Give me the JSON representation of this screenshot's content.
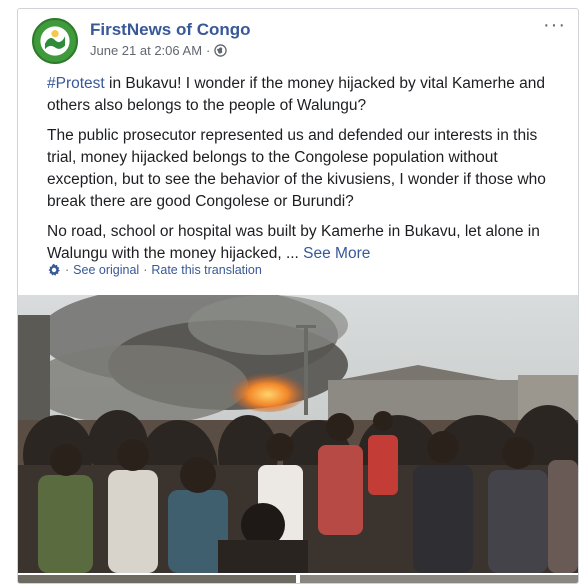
{
  "post": {
    "author": "FirstNews of Congo",
    "timestamp": "June 21 at 2:06 AM",
    "meta_separator": "·",
    "privacy_icon": "globe-icon",
    "more_label": "···",
    "paragraph1_hashtag": "#Protest",
    "paragraph1_rest": " in Bukavu! I wonder if the money hijacked by vital Kamerhe and others also belongs to the people of Walungu?",
    "paragraph2": "The public prosecutor represented us and defended our interests in this trial, money hijacked belongs to the Congolese population without exception, but to see the behavior of the kivusiens, I wonder if those who break there are good Congolese or Burundi?",
    "paragraph3": "No road, school or hospital was built by Kamerhe in Bukavu, let alone in Walungu with the money hijacked, ... ",
    "see_more": "See More",
    "translation": {
      "icon": "gear-icon",
      "see_original": "See original",
      "separator": "·",
      "rate": "Rate this translation"
    },
    "photo_icon": "protest-photo",
    "colors": {
      "link": "#385898",
      "meta": "#616770",
      "avatar": "#3f9a3c"
    }
  }
}
